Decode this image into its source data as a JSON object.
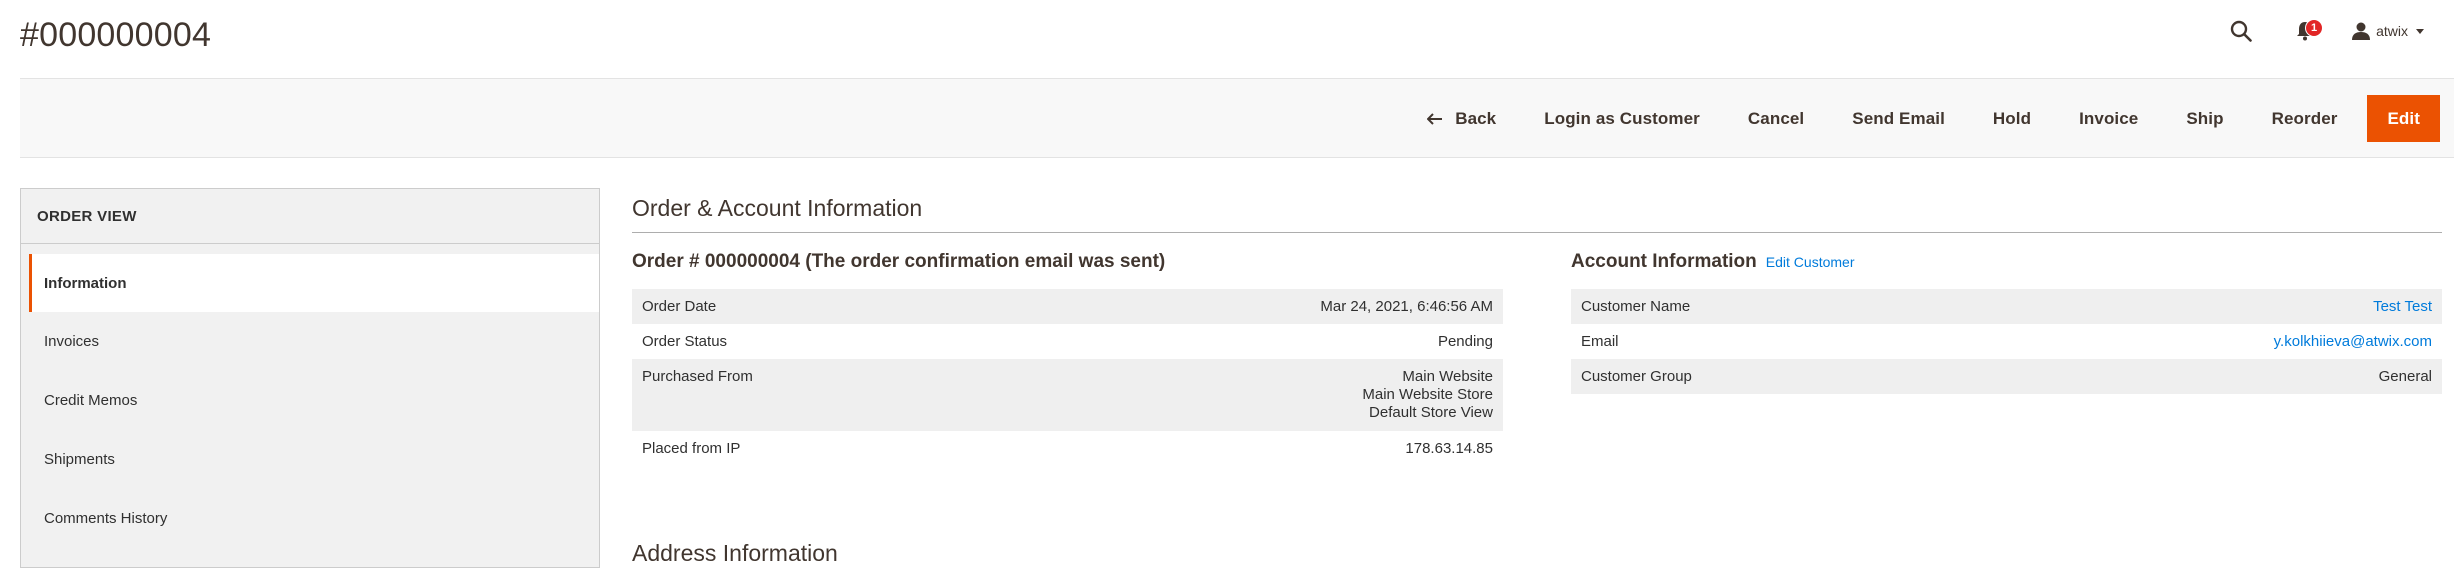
{
  "page": {
    "title": "#000000004"
  },
  "header": {
    "search_icon": "search-icon",
    "notifications_icon": "bell-icon",
    "notifications_count": "1",
    "user_icon": "user-icon",
    "user_name": "atwix"
  },
  "actions": {
    "back": "Back",
    "login_as_customer": "Login as Customer",
    "cancel": "Cancel",
    "send_email": "Send Email",
    "hold": "Hold",
    "invoice": "Invoice",
    "ship": "Ship",
    "reorder": "Reorder",
    "edit": "Edit"
  },
  "sidebar": {
    "title": "ORDER VIEW",
    "items": [
      {
        "label": "Information",
        "active": true
      },
      {
        "label": "Invoices",
        "active": false
      },
      {
        "label": "Credit Memos",
        "active": false
      },
      {
        "label": "Shipments",
        "active": false
      },
      {
        "label": "Comments History",
        "active": false
      }
    ]
  },
  "main": {
    "section_title": "Order & Account Information",
    "order": {
      "title": "Order # 000000004 (The order confirmation email was sent)",
      "rows": [
        {
          "label": "Order Date",
          "value": "Mar 24, 2021, 6:46:56 AM"
        },
        {
          "label": "Order Status",
          "value": "Pending"
        },
        {
          "label": "Purchased From",
          "value_lines": [
            "Main Website",
            "Main Website Store",
            "Default Store View"
          ]
        },
        {
          "label": "Placed from IP",
          "value": "178.63.14.85"
        }
      ]
    },
    "account": {
      "title": "Account Information",
      "edit_link": "Edit Customer",
      "rows": [
        {
          "label": "Customer Name",
          "value": "Test Test"
        },
        {
          "label": "Email",
          "value": "y.kolkhiieva@atwix.com"
        },
        {
          "label": "Customer Group",
          "value": "General"
        }
      ]
    },
    "address_title": "Address Information"
  },
  "colors": {
    "accent": "#eb5202",
    "link": "#007bdb",
    "badge": "#e22626"
  }
}
